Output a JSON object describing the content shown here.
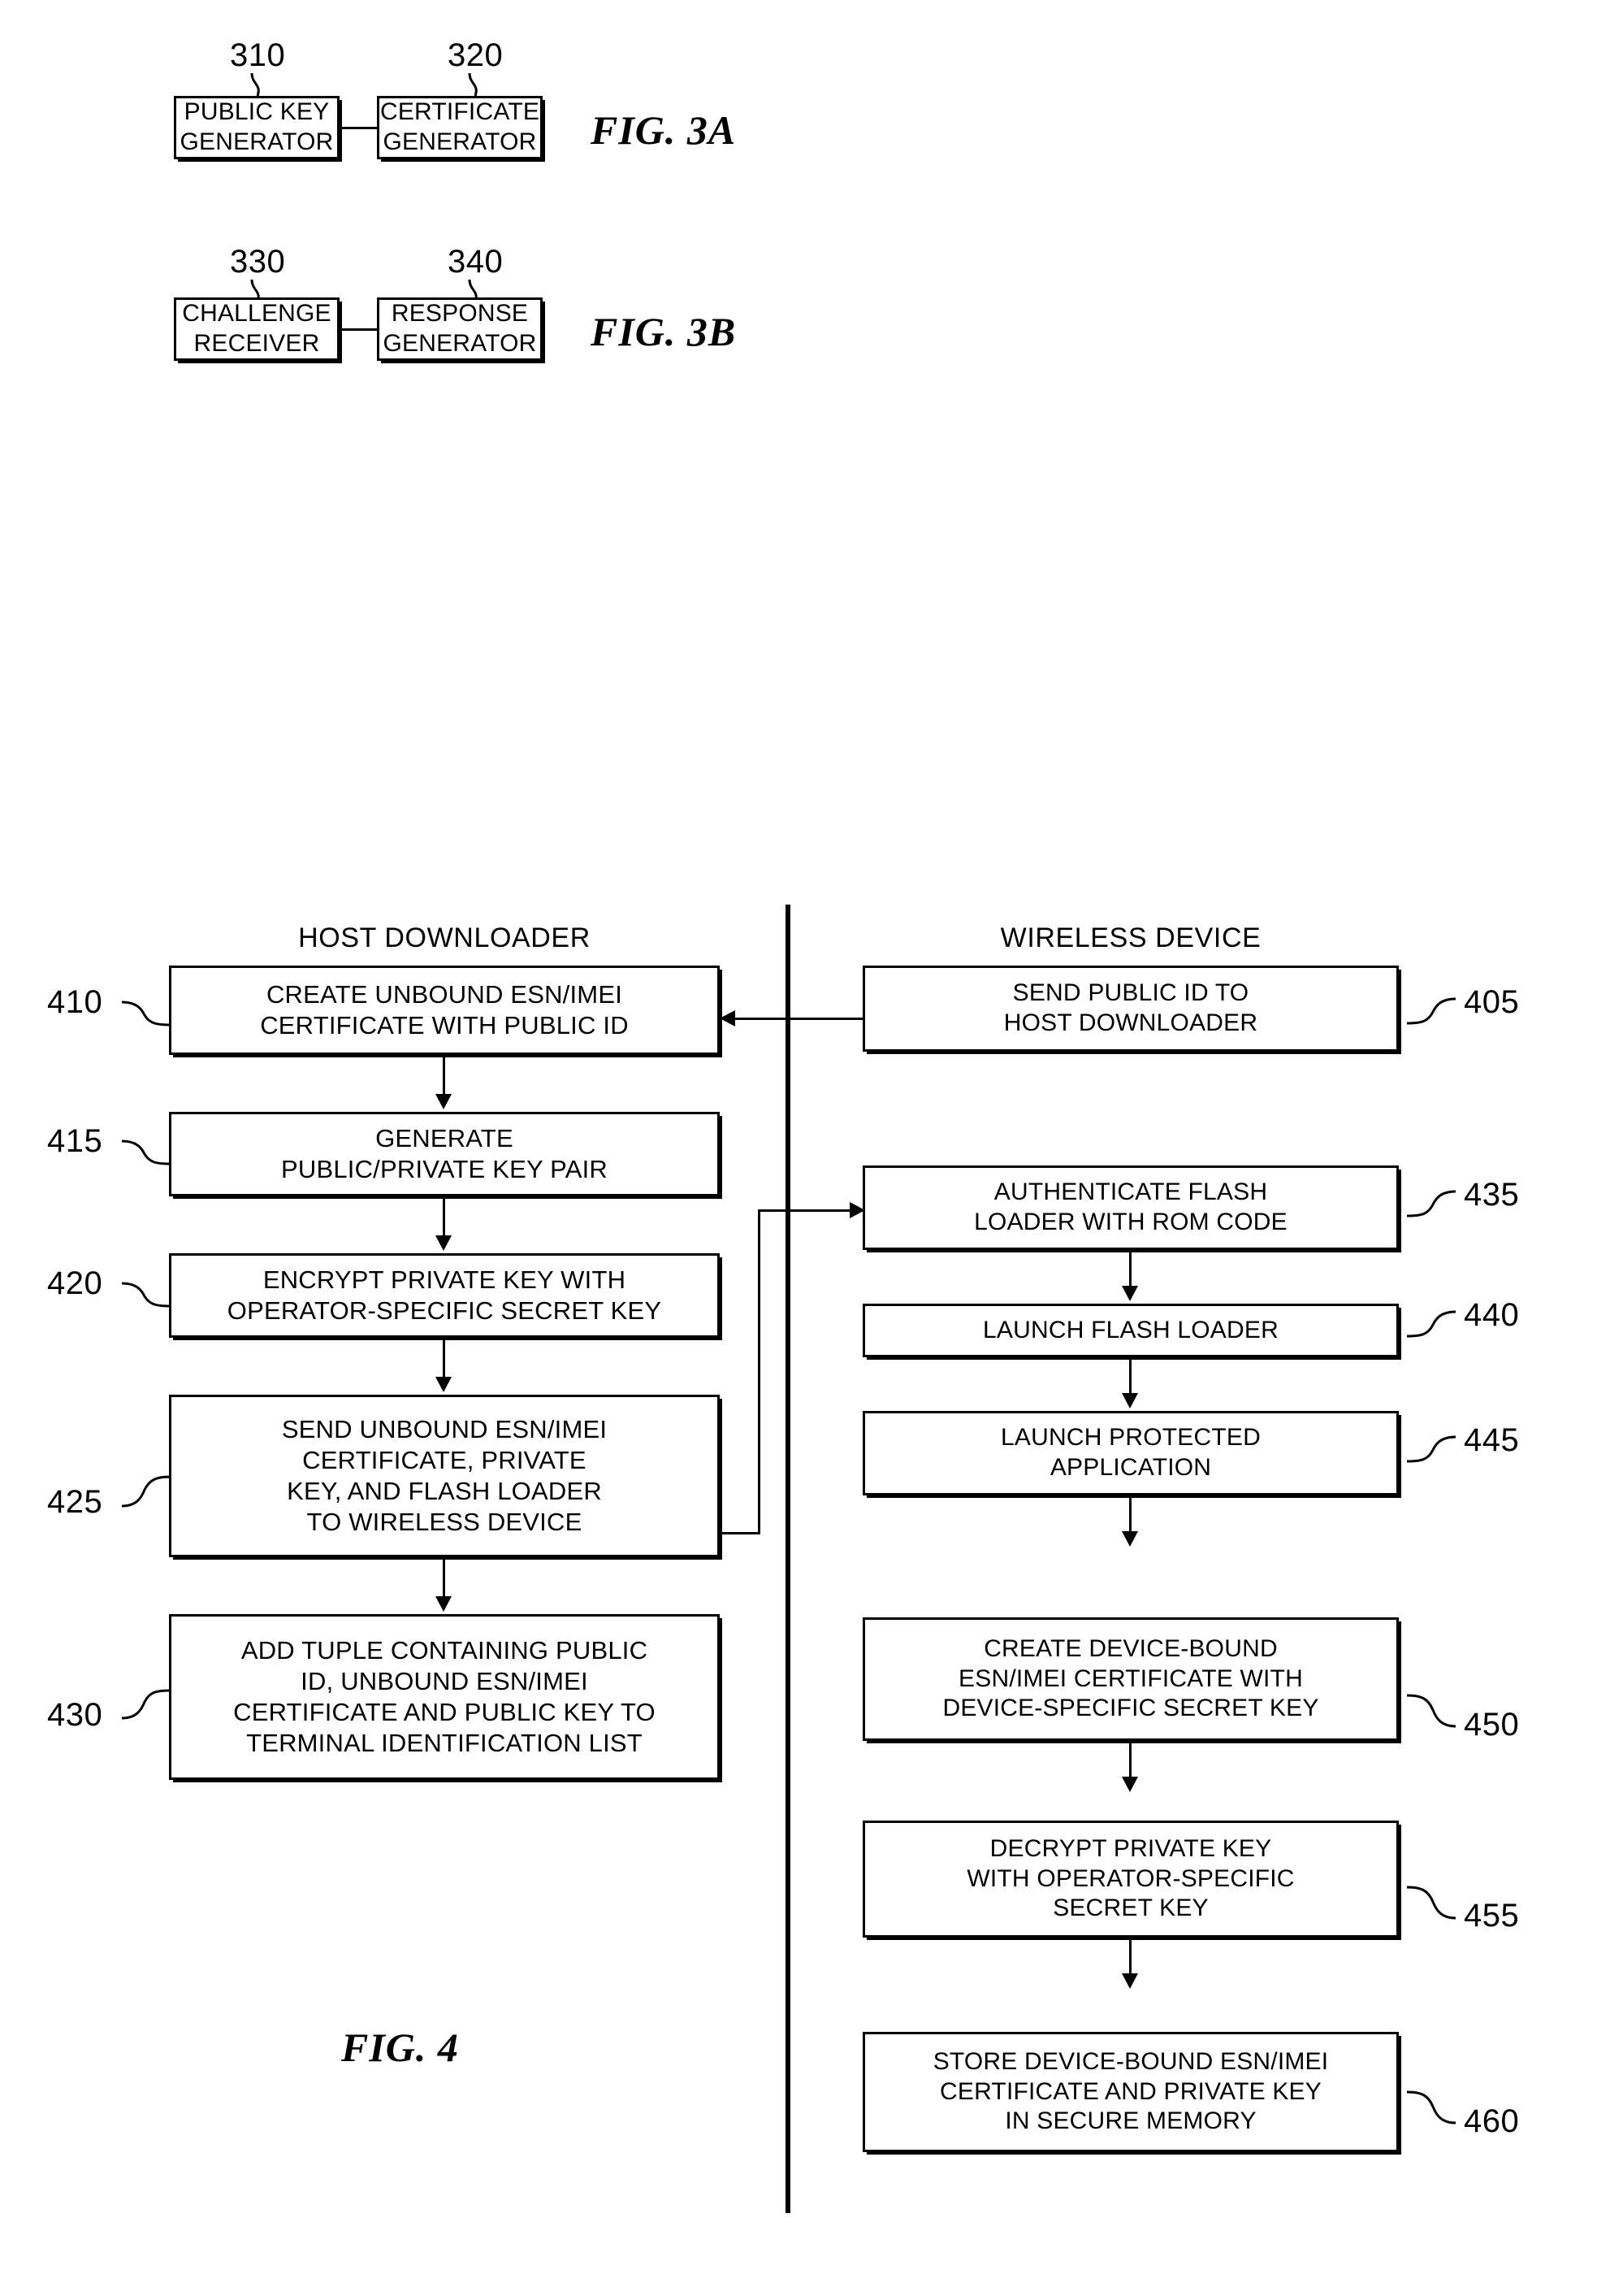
{
  "figures": [
    {
      "id": "fig-3a",
      "caption": "FIG. 3A",
      "blocks": [
        {
          "ref": "310",
          "label": "PUBLIC KEY\nGENERATOR"
        },
        {
          "ref": "320",
          "label": "CERTIFICATE\nGENERATOR"
        }
      ]
    },
    {
      "id": "fig-3b",
      "caption": "FIG. 3B",
      "blocks": [
        {
          "ref": "330",
          "label": "CHALLENGE\nRECEIVER"
        },
        {
          "ref": "340",
          "label": "RESPONSE\nGENERATOR"
        }
      ]
    }
  ],
  "fig4": {
    "caption": "FIG. 4",
    "columns": {
      "left_header": "HOST DOWNLOADER",
      "right_header": "WIRELESS DEVICE"
    },
    "left_steps": [
      {
        "ref": "410",
        "label": "CREATE UNBOUND ESN/IMEI\nCERTIFICATE WITH PUBLIC ID"
      },
      {
        "ref": "415",
        "label": "GENERATE\nPUBLIC/PRIVATE KEY PAIR"
      },
      {
        "ref": "420",
        "label": "ENCRYPT PRIVATE KEY WITH\nOPERATOR-SPECIFIC SECRET KEY"
      },
      {
        "ref": "425",
        "label": "SEND UNBOUND ESN/IMEI\nCERTIFICATE, PRIVATE\nKEY, AND FLASH LOADER\nTO WIRELESS DEVICE"
      },
      {
        "ref": "430",
        "label": "ADD TUPLE CONTAINING PUBLIC\nID, UNBOUND ESN/IMEI\nCERTIFICATE AND PUBLIC KEY TO\nTERMINAL IDENTIFICATION LIST"
      }
    ],
    "right_steps": [
      {
        "ref": "405",
        "label": "SEND PUBLIC ID TO\nHOST DOWNLOADER"
      },
      {
        "ref": "435",
        "label": "AUTHENTICATE FLASH\nLOADER WITH ROM CODE"
      },
      {
        "ref": "440",
        "label": "LAUNCH FLASH LOADER"
      },
      {
        "ref": "445",
        "label": "LAUNCH PROTECTED\nAPPLICATION"
      },
      {
        "ref": "450",
        "label": "CREATE DEVICE-BOUND\nESN/IMEI CERTIFICATE WITH\nDEVICE-SPECIFIC SECRET KEY"
      },
      {
        "ref": "455",
        "label": "DECRYPT PRIVATE KEY\nWITH OPERATOR-SPECIFIC\nSECRET KEY"
      },
      {
        "ref": "460",
        "label": "STORE DEVICE-BOUND ESN/IMEI\nCERTIFICATE AND PRIVATE KEY\nIN SECURE MEMORY"
      }
    ]
  },
  "colors": {
    "ink": "#000000",
    "paper": "#ffffff"
  }
}
